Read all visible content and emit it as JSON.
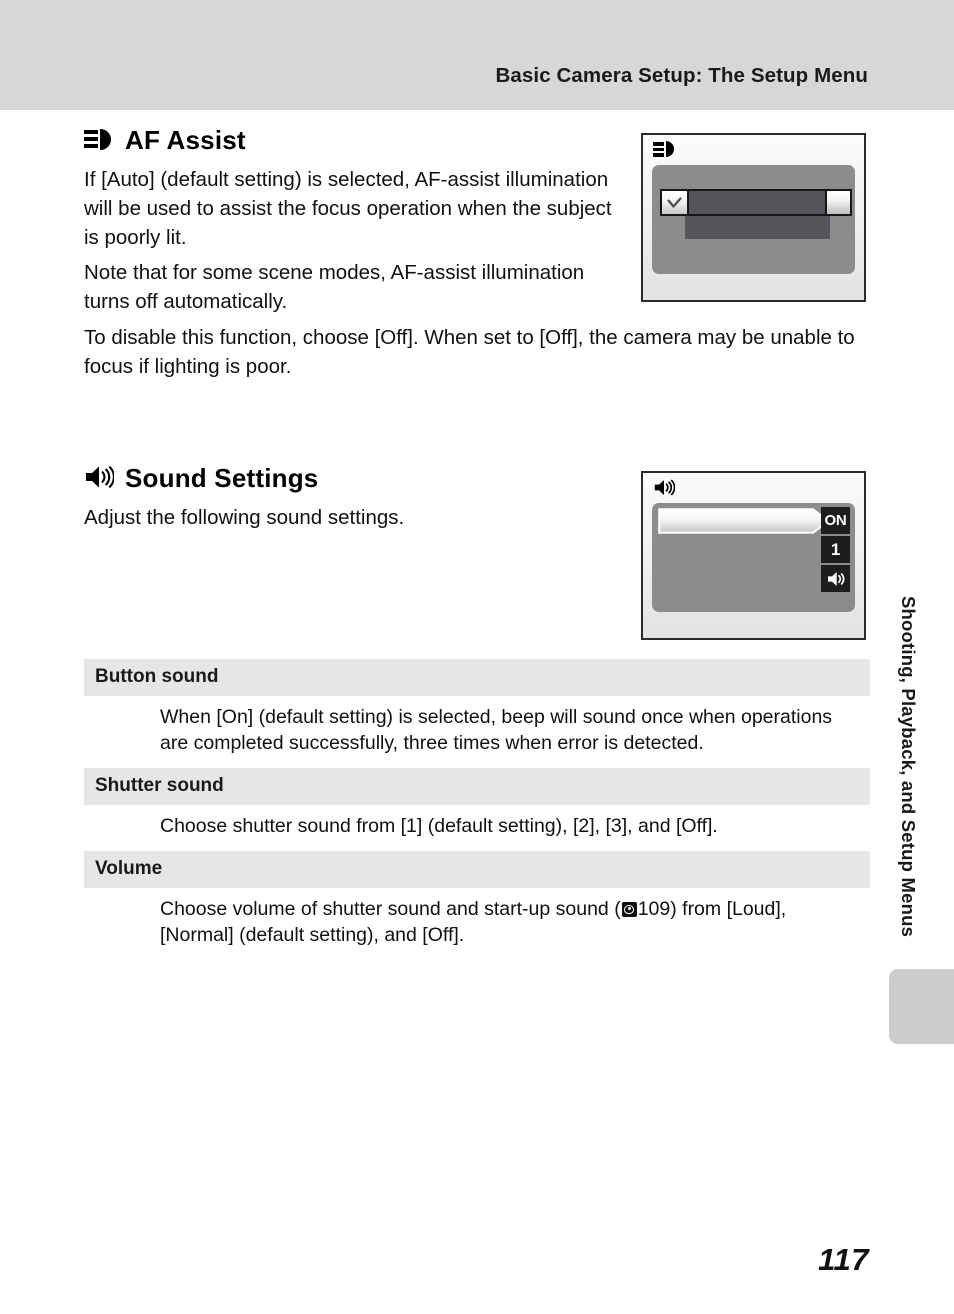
{
  "header": {
    "title": "Basic Camera Setup: The Setup Menu"
  },
  "sections": [
    {
      "id": "af-assist",
      "icon": "af-assist-lamp-icon",
      "title": "AF Assist",
      "paragraphs": [
        "If [Auto] (default setting) is selected, AF-assist illumination will be used to assist the focus operation when the subject is poorly lit.",
        "Note that for some scene modes, AF-assist illumination turns off automatically.",
        "To disable this function, choose [Off]. When set to [Off], the camera may be unable to focus if lighting is poor."
      ],
      "figure": {
        "name": "af-assist-camera-screen",
        "title_icon": "af-assist-lamp-icon",
        "selected_row_icon": "checkmark-icon"
      }
    },
    {
      "id": "sound-settings",
      "icon": "speaker-icon",
      "title": "Sound Settings",
      "paragraphs": [
        "Adjust the following sound settings."
      ],
      "figure": {
        "name": "sound-settings-camera-screen",
        "title_icon": "speaker-icon",
        "badges": [
          {
            "name": "badge-on",
            "label": "ON"
          },
          {
            "name": "badge-shutter-sound",
            "label": "1"
          },
          {
            "name": "badge-volume",
            "label": "speaker-icon"
          }
        ]
      }
    }
  ],
  "definition_table": [
    {
      "term": "Button sound",
      "description": "When [On] (default setting) is selected, beep will sound once when operations are completed successfully, three times when error is detected."
    },
    {
      "term": "Shutter sound",
      "description": "Choose shutter sound from [1] (default setting), [2], [3], and [Off]."
    },
    {
      "term": "Volume",
      "description_before_ref": "Choose volume of shutter sound and start-up sound (",
      "ref_icon": "reference-eye-icon",
      "ref_page": "109",
      "description_after_ref": ") from [Loud], [Normal] (default setting), and [Off]."
    }
  ],
  "side_tab": {
    "label": "Shooting, Playback, and Setup Menus"
  },
  "page_number": "117",
  "colors": {
    "header_band": "#d7d7d7",
    "table_header": "#e6e6e6",
    "screen_panel": "#8c8c8c",
    "screen_row_dark": "#555659",
    "side_tab_marker": "#cccccc"
  }
}
